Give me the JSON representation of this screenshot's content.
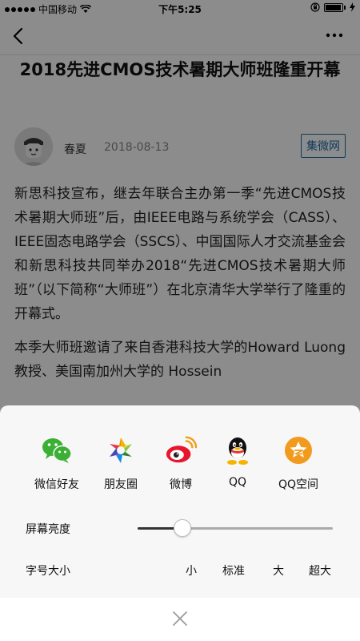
{
  "status_bar": {
    "carrier": "中国移动",
    "time": "下午5:25",
    "icons": [
      "signal-dots",
      "wifi-icon",
      "lock-rotation-icon",
      "battery-icon",
      "charging-icon"
    ]
  },
  "nav": {
    "back_icon": "back-chevron-icon",
    "more_icon": "more-dots-icon"
  },
  "article": {
    "title": "2018先进CMOS技术暑期大师班隆重开幕",
    "author": "春夏",
    "date": "2018-08-13",
    "source": "集微网",
    "paragraphs": [
      "新思科技宣布，继去年联合主办第一季“先进CMOS技术暑期大师班”后，由IEEE电路与系统学会（CASS）、IEEE固态电路学会（SSCS）、中国国际人才交流基金会和新思科技共同举办2018“先进CMOS技术暑期大师班”（以下简称“大师班”）在北京清华大学举行了隆重的开幕式。",
      "本季大师班邀请了来自香港科技大学的Howard Luong 教授、美国南加州大学的 Hossein"
    ]
  },
  "share_sheet": {
    "items": [
      {
        "label": "微信好友",
        "icon": "wechat-icon"
      },
      {
        "label": "朋友圈",
        "icon": "moments-icon"
      },
      {
        "label": "微博",
        "icon": "weibo-icon"
      },
      {
        "label": "QQ",
        "icon": "qq-icon"
      },
      {
        "label": "QQ空间",
        "icon": "qzone-icon"
      }
    ],
    "brightness_label": "屏幕亮度",
    "brightness_level": 0.23,
    "font_size_label": "字号大小",
    "font_size_options": [
      "小",
      "标准",
      "大",
      "超大"
    ],
    "close_icon": "close-icon"
  },
  "colors": {
    "link_blue": "#1a6aa8",
    "wechat_green": "#3cb034",
    "qzone_orange": "#f29a1d",
    "weibo_red": "#e6162d"
  }
}
